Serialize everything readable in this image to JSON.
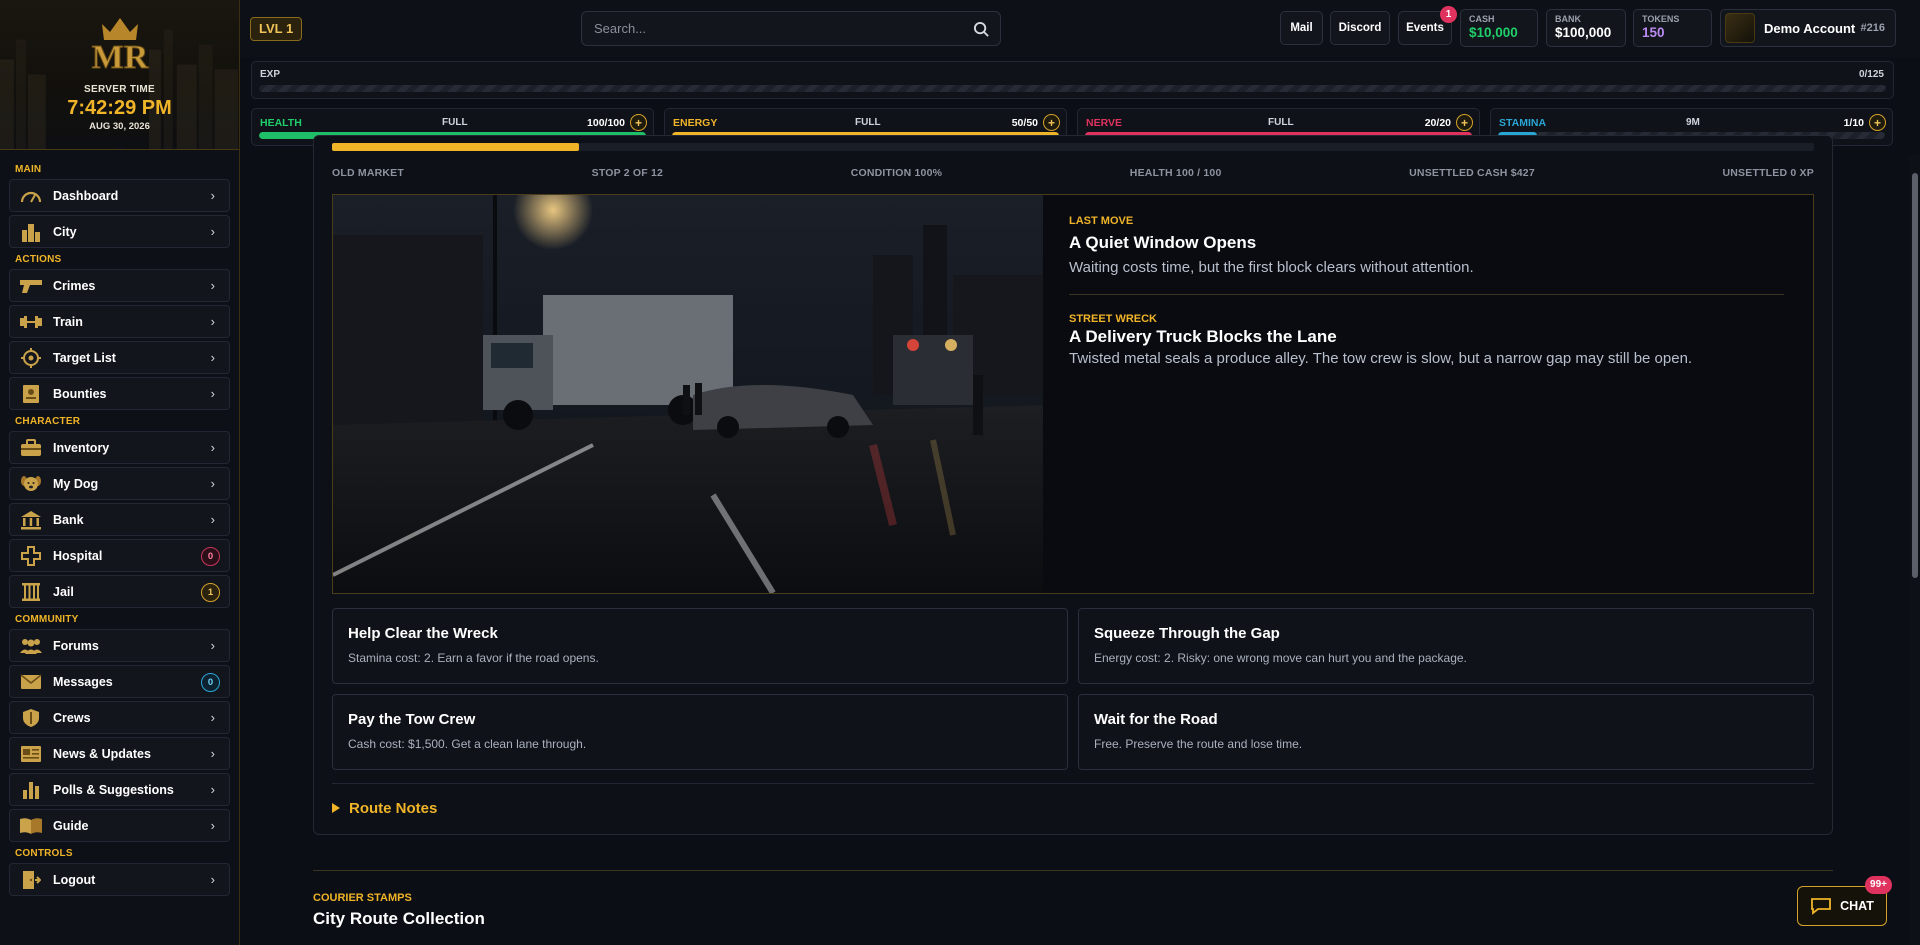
{
  "server": {
    "label": "SERVER TIME",
    "time": "7:42:29 PM",
    "date": "AUG 30, 2026"
  },
  "nav": {
    "main_label": "MAIN",
    "actions_label": "ACTIONS",
    "character_label": "CHARACTER",
    "community_label": "COMMUNITY",
    "controls_label": "CONTROLS",
    "items": {
      "dashboard": "Dashboard",
      "city": "City",
      "crimes": "Crimes",
      "train": "Train",
      "target_list": "Target List",
      "bounties": "Bounties",
      "inventory": "Inventory",
      "my_dog": "My Dog",
      "bank": "Bank",
      "hospital": "Hospital",
      "hospital_badge": "0",
      "jail": "Jail",
      "jail_badge": "1",
      "forums": "Forums",
      "messages": "Messages",
      "messages_badge": "0",
      "crews": "Crews",
      "news": "News & Updates",
      "polls": "Polls & Suggestions",
      "guide": "Guide",
      "logout": "Logout"
    }
  },
  "header": {
    "level": "LVL 1",
    "search_placeholder": "Search...",
    "mail": "Mail",
    "discord": "Discord",
    "events": "Events",
    "events_badge": "1",
    "cash_label": "CASH",
    "cash_value": "$10,000",
    "bank_label": "BANK",
    "bank_value": "$100,000",
    "tokens_label": "TOKENS",
    "tokens_value": "150",
    "account_name": "Demo Account",
    "account_id": "#216"
  },
  "exp": {
    "label": "EXP",
    "value": "0/125",
    "fraction": 0
  },
  "vitals": {
    "health": {
      "label": "HEALTH",
      "status": "FULL",
      "value": "100/100",
      "fraction": 1.0,
      "color": "#1fbf6a"
    },
    "energy": {
      "label": "ENERGY",
      "status": "FULL",
      "value": "50/50",
      "fraction": 1.0,
      "color": "#f0b429"
    },
    "nerve": {
      "label": "NERVE",
      "status": "FULL",
      "value": "20/20",
      "fraction": 1.0,
      "color": "#e0325f"
    },
    "stamina": {
      "label": "STAMINA",
      "status": "9M",
      "value": "1/10",
      "fraction": 0.1,
      "color": "#2aa6d4"
    }
  },
  "run": {
    "progress_fraction": 0.1667,
    "location": "OLD MARKET",
    "stop": "STOP 2 OF 12",
    "condition": "CONDITION 100%",
    "health": "HEALTH 100 / 100",
    "cash": "UNSETTLED CASH $427",
    "xp": "UNSETTLED 0 XP"
  },
  "story": {
    "last_tag": "LAST MOVE",
    "last_title": "A Quiet Window Opens",
    "last_text": "Waiting costs time, but the first block clears without attention.",
    "event_tag": "STREET WRECK",
    "event_title": "A Delivery Truck Blocks the Lane",
    "event_text": "Twisted metal seals a produce alley. The tow crew is slow, but a narrow gap may still be open."
  },
  "choices": [
    {
      "title": "Help Clear the Wreck",
      "desc": "Stamina cost: 2. Earn a favor if the road opens."
    },
    {
      "title": "Squeeze Through the Gap",
      "desc": "Energy cost: 2. Risky: one wrong move can hurt you and the package."
    },
    {
      "title": "Pay the Tow Crew",
      "desc": "Cash cost: $1,500. Get a clean lane through."
    },
    {
      "title": "Wait for the Road",
      "desc": "Free. Preserve the route and lose time."
    }
  ],
  "route_notes": "Route Notes",
  "stamps": {
    "tag": "COURIER STAMPS",
    "title": "City Route Collection"
  },
  "chat": {
    "label": "CHAT",
    "badge": "99+"
  },
  "colors": {
    "accent": "#f0b429",
    "bg": "#0b0e14",
    "panel": "#0d1016"
  }
}
